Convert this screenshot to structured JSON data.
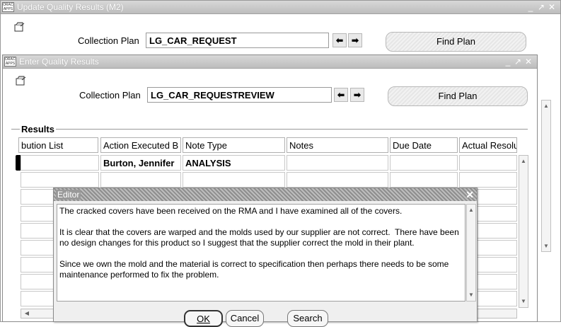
{
  "back_window": {
    "title": "Update Quality Results (M2)",
    "collection_plan_label": "Collection Plan",
    "collection_plan_value": "LG_CAR_REQUEST",
    "find_plan_label": "Find Plan"
  },
  "front_window": {
    "title": "Enter Quality Results",
    "collection_plan_label": "Collection Plan",
    "collection_plan_value": "LG_CAR_REQUESTREVIEW",
    "find_plan_label": "Find Plan",
    "results_section": "Results",
    "columns": [
      "bution List",
      "Action Executed B",
      "Note Type",
      "Notes",
      "Due Date",
      "Actual Resolu"
    ],
    "rows": [
      [
        "",
        "Burton, Jennifer",
        "ANALYSIS",
        "",
        "",
        ""
      ]
    ]
  },
  "editor": {
    "title": "Editor",
    "text": "The cracked covers have been received on the RMA and I have examined all of the covers.\n\nIt is clear that the covers are warped and the molds used by our supplier are not correct.  There have been no design changes for this product so I suggest that the supplier correct the mold in their plant.\n\nSince we own the mold and the material is correct to specification then perhaps there needs to be some maintenance performed to fix the problem.",
    "ok_label": "OK",
    "cancel_label": "Cancel",
    "search_label": "Search"
  },
  "icons": {
    "app_logo": "oracle-logo-icon",
    "toolbar": "open-folder-icon",
    "prev": "arrow-left-icon",
    "next": "arrow-right-icon"
  }
}
